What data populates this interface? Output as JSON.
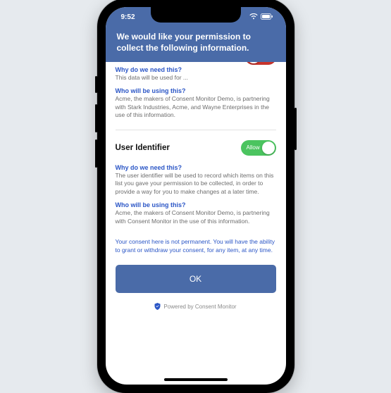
{
  "statusbar": {
    "time": "9:52"
  },
  "header": {
    "title": "We would like your permission to collect the following information."
  },
  "section_top": {
    "why_head": "Why do we need this?",
    "why_body": "This data will be used for ...",
    "who_head": "Who will be using this?",
    "who_body": "Acme, the makers of Consent Monitor Demo, is partnering with Stark Industries, Acme, and Wayne Enterprises in the use of this information."
  },
  "section_user_id": {
    "title": "User Identifier",
    "toggle_label": "Allow",
    "toggle_state": "on",
    "why_head": "Why do we need this?",
    "why_body": "The user identifier will be used to record which items on this list you gave your permission to be collected, in order to provide a way for you to make changes at a later time.",
    "who_head": "Who will be using this?",
    "who_body": "Acme, the makers of Consent Monitor Demo, is partnering with Consent Monitor in the use of this information."
  },
  "footer": {
    "note": "Your consent here is not permanent. You will have the ability to grant or withdraw your consent, for any item, at any time.",
    "ok_label": "OK",
    "powered": "Powered by Consent Monitor"
  }
}
